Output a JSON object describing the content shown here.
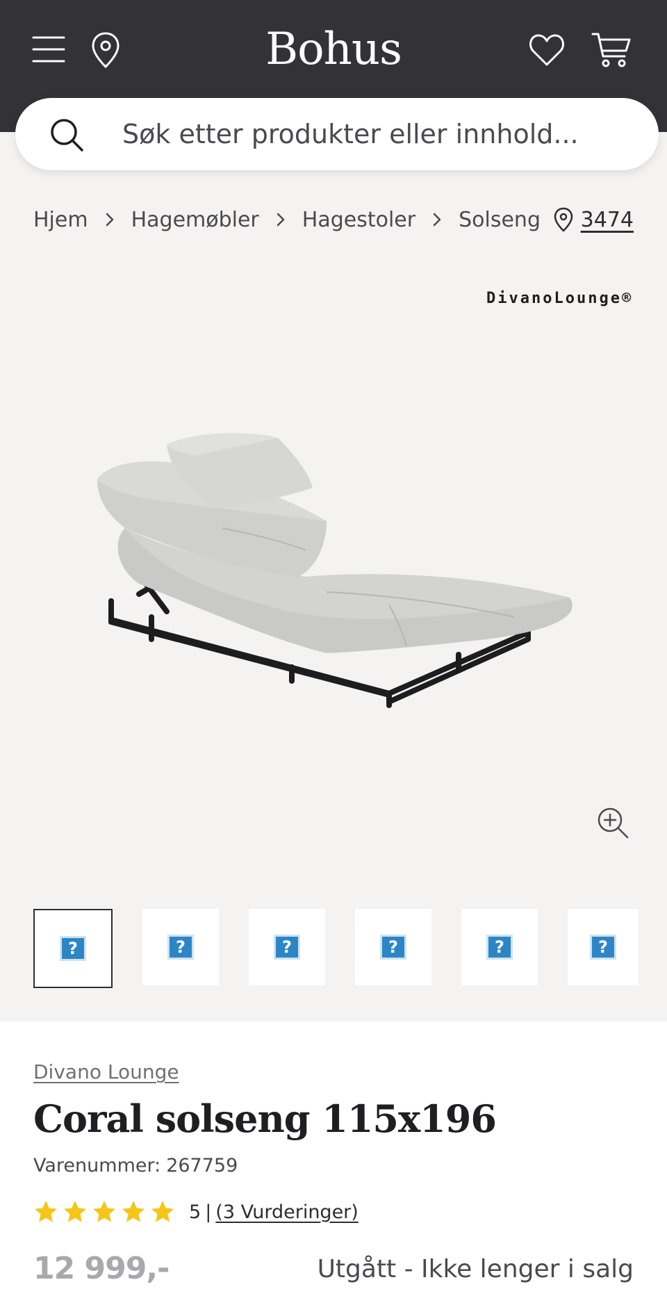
{
  "header": {
    "logo": "Bohus",
    "icons": {
      "menu": "menu-icon",
      "location": "location-pin-icon",
      "wishlist": "heart-icon",
      "cart": "cart-icon"
    },
    "bg_color": "#333236"
  },
  "search": {
    "placeholder": "Søk etter produkter eller innhold..."
  },
  "breadcrumb": {
    "items": [
      "Hjem",
      "Hagemøbler",
      "Hagestoler",
      "Solseng"
    ]
  },
  "store": {
    "number": "3474"
  },
  "gallery": {
    "brand_watermark": "DivanoLounge®",
    "thumbnail_count": 6,
    "active_thumbnail": 1
  },
  "product": {
    "brand": "Divano Lounge",
    "title": "Coral solseng 115x196",
    "sku_label": "Varenummer:",
    "sku": "267759",
    "rating": {
      "stars": 5,
      "score": "5",
      "separator": "|",
      "reviews_link": "(3 Vurderinger)"
    },
    "price": "12 999,-",
    "availability": "Utgått - Ikke lenger i salg"
  },
  "colors": {
    "star": "#f5c518",
    "header": "#333236",
    "page_bg": "#f4f3f2"
  }
}
